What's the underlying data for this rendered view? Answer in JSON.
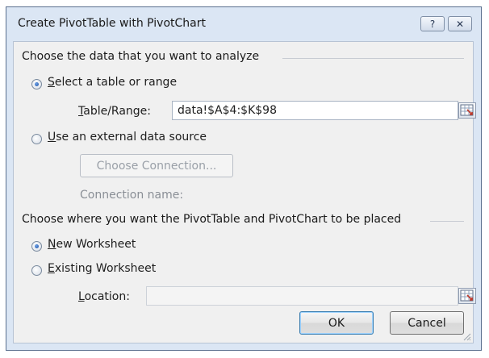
{
  "window": {
    "title": "Create PivotTable with PivotChart",
    "help_glyph": "?",
    "close_glyph": "✕"
  },
  "data_section": {
    "heading": "Choose the data that you want to analyze",
    "select_range": {
      "accel": "S",
      "label_rest": "elect a table or range",
      "selected": true
    },
    "table_range": {
      "accel": "T",
      "label_rest": "able/Range:",
      "value": "data!$A$4:$K$98"
    },
    "external_source": {
      "accel": "U",
      "label_rest": "se an external data source",
      "selected": false
    },
    "choose_connection_label": "Choose Connection...",
    "connection_name_label": "Connection name:"
  },
  "placement_section": {
    "heading": "Choose where you want the PivotTable and PivotChart to be placed",
    "new_worksheet": {
      "accel": "N",
      "label_rest": "ew Worksheet",
      "selected": true
    },
    "existing_worksheet": {
      "accel": "E",
      "label_rest": "xisting Worksheet",
      "selected": false
    },
    "location": {
      "accel": "L",
      "label_rest": "ocation:",
      "value": ""
    }
  },
  "buttons": {
    "ok": "OK",
    "cancel": "Cancel"
  },
  "icons": {
    "collapse_dialog": "range-selector-icon",
    "resize": "resize-grip-icon"
  }
}
